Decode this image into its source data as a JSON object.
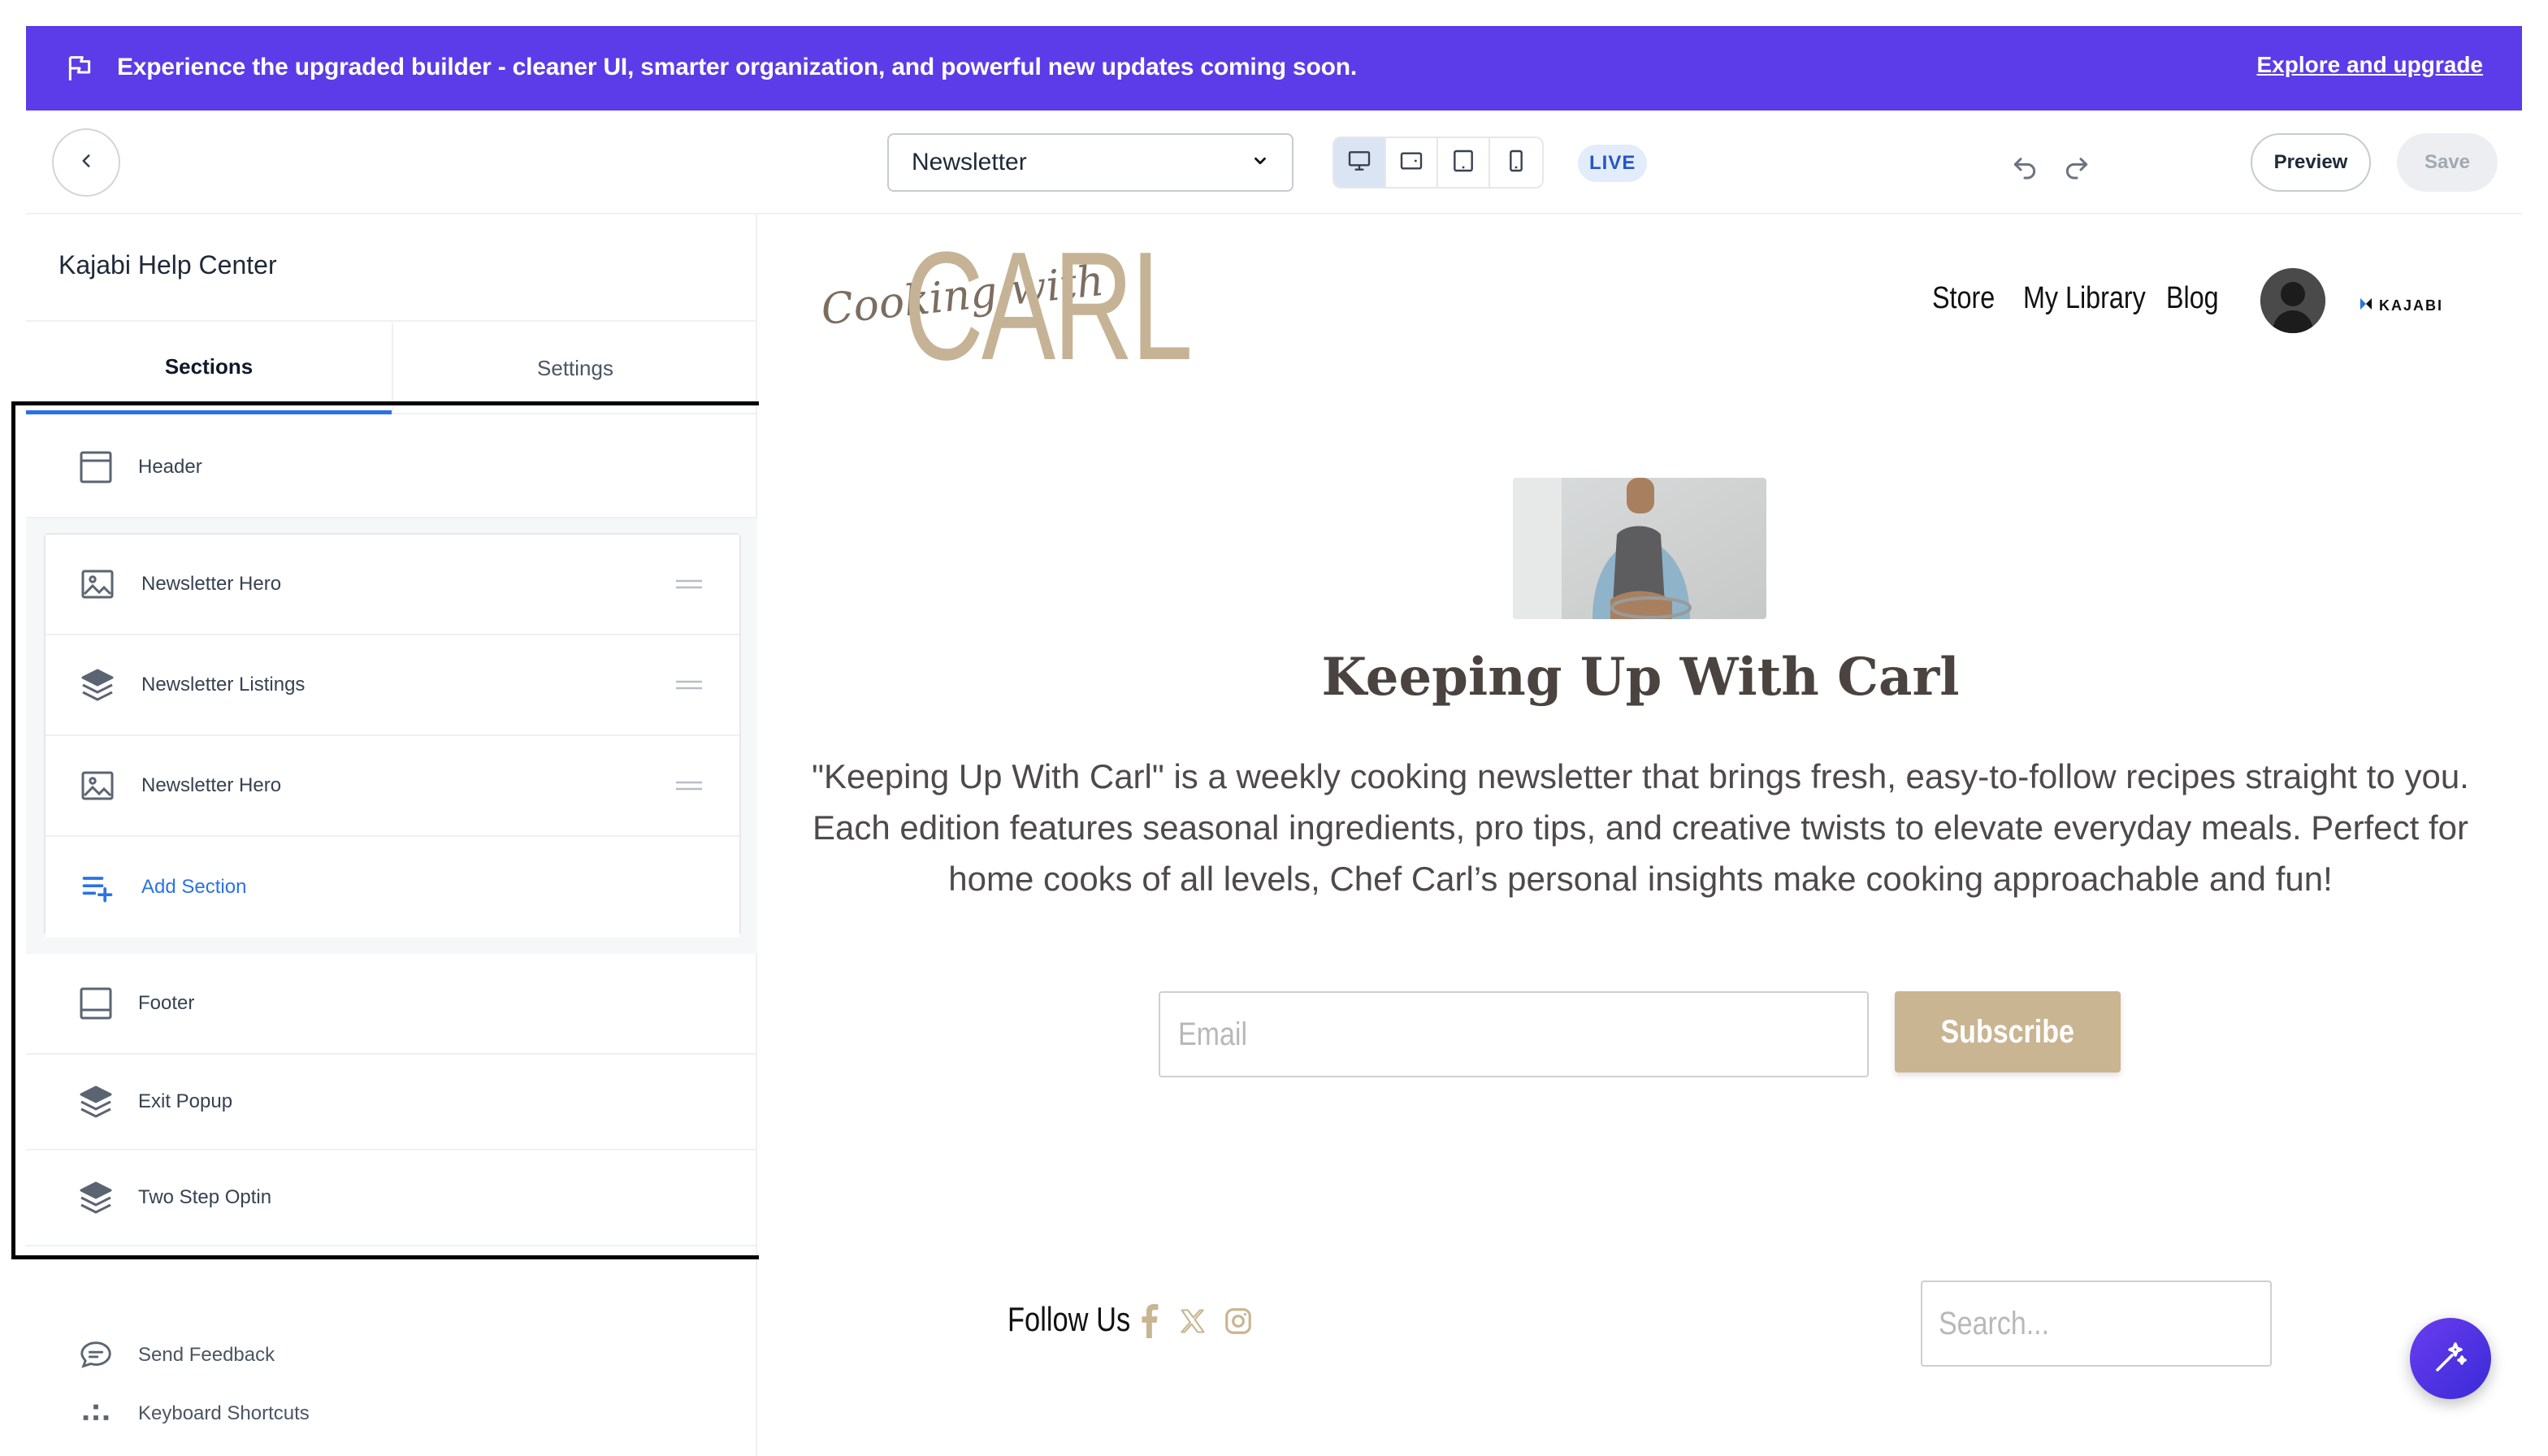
{
  "banner": {
    "message": "Experience the upgraded builder - cleaner UI, smarter organization, and powerful new updates coming soon.",
    "link": "Explore and upgrade",
    "color": "#5B3CE8"
  },
  "toolbar": {
    "page_select": "Newsletter",
    "devices": [
      "desktop-icon",
      "laptop-icon",
      "tablet-icon",
      "mobile-icon"
    ],
    "live_badge": "LIVE",
    "preview_label": "Preview",
    "save_label": "Save"
  },
  "sidebar": {
    "help_title": "Kajabi Help Center",
    "tabs": [
      "Sections",
      "Settings"
    ],
    "header_section": "Header",
    "content_sections": [
      {
        "label": "Newsletter Hero",
        "icon": "image-icon"
      },
      {
        "label": "Newsletter Listings",
        "icon": "layers-icon"
      },
      {
        "label": "Newsletter Hero",
        "icon": "image-icon"
      }
    ],
    "add_section": "Add Section",
    "footer_section": "Footer",
    "popups": [
      "Exit Popup",
      "Two Step Optin"
    ],
    "utilities": [
      "Send Feedback",
      "Keyboard Shortcuts"
    ]
  },
  "site": {
    "logo_script": "Cooking with",
    "logo_main": "CARL",
    "nav": [
      "Store",
      "My Library",
      "Blog"
    ],
    "badge": "KAJABI",
    "title": "Keeping Up With Carl",
    "description": "\"Keeping Up With Carl\" is a weekly cooking newsletter that brings fresh, easy-to-follow recipes straight to you. Each edition features seasonal ingredients, pro tips, and creative twists to elevate everyday meals. Perfect for home cooks of all levels, Chef Carl’s personal insights make cooking approachable and fun!",
    "email_placeholder": "Email",
    "subscribe_label": "Subscribe",
    "follow_label": "Follow Us",
    "search_placeholder": "Search...",
    "accent": "#C9B592"
  }
}
